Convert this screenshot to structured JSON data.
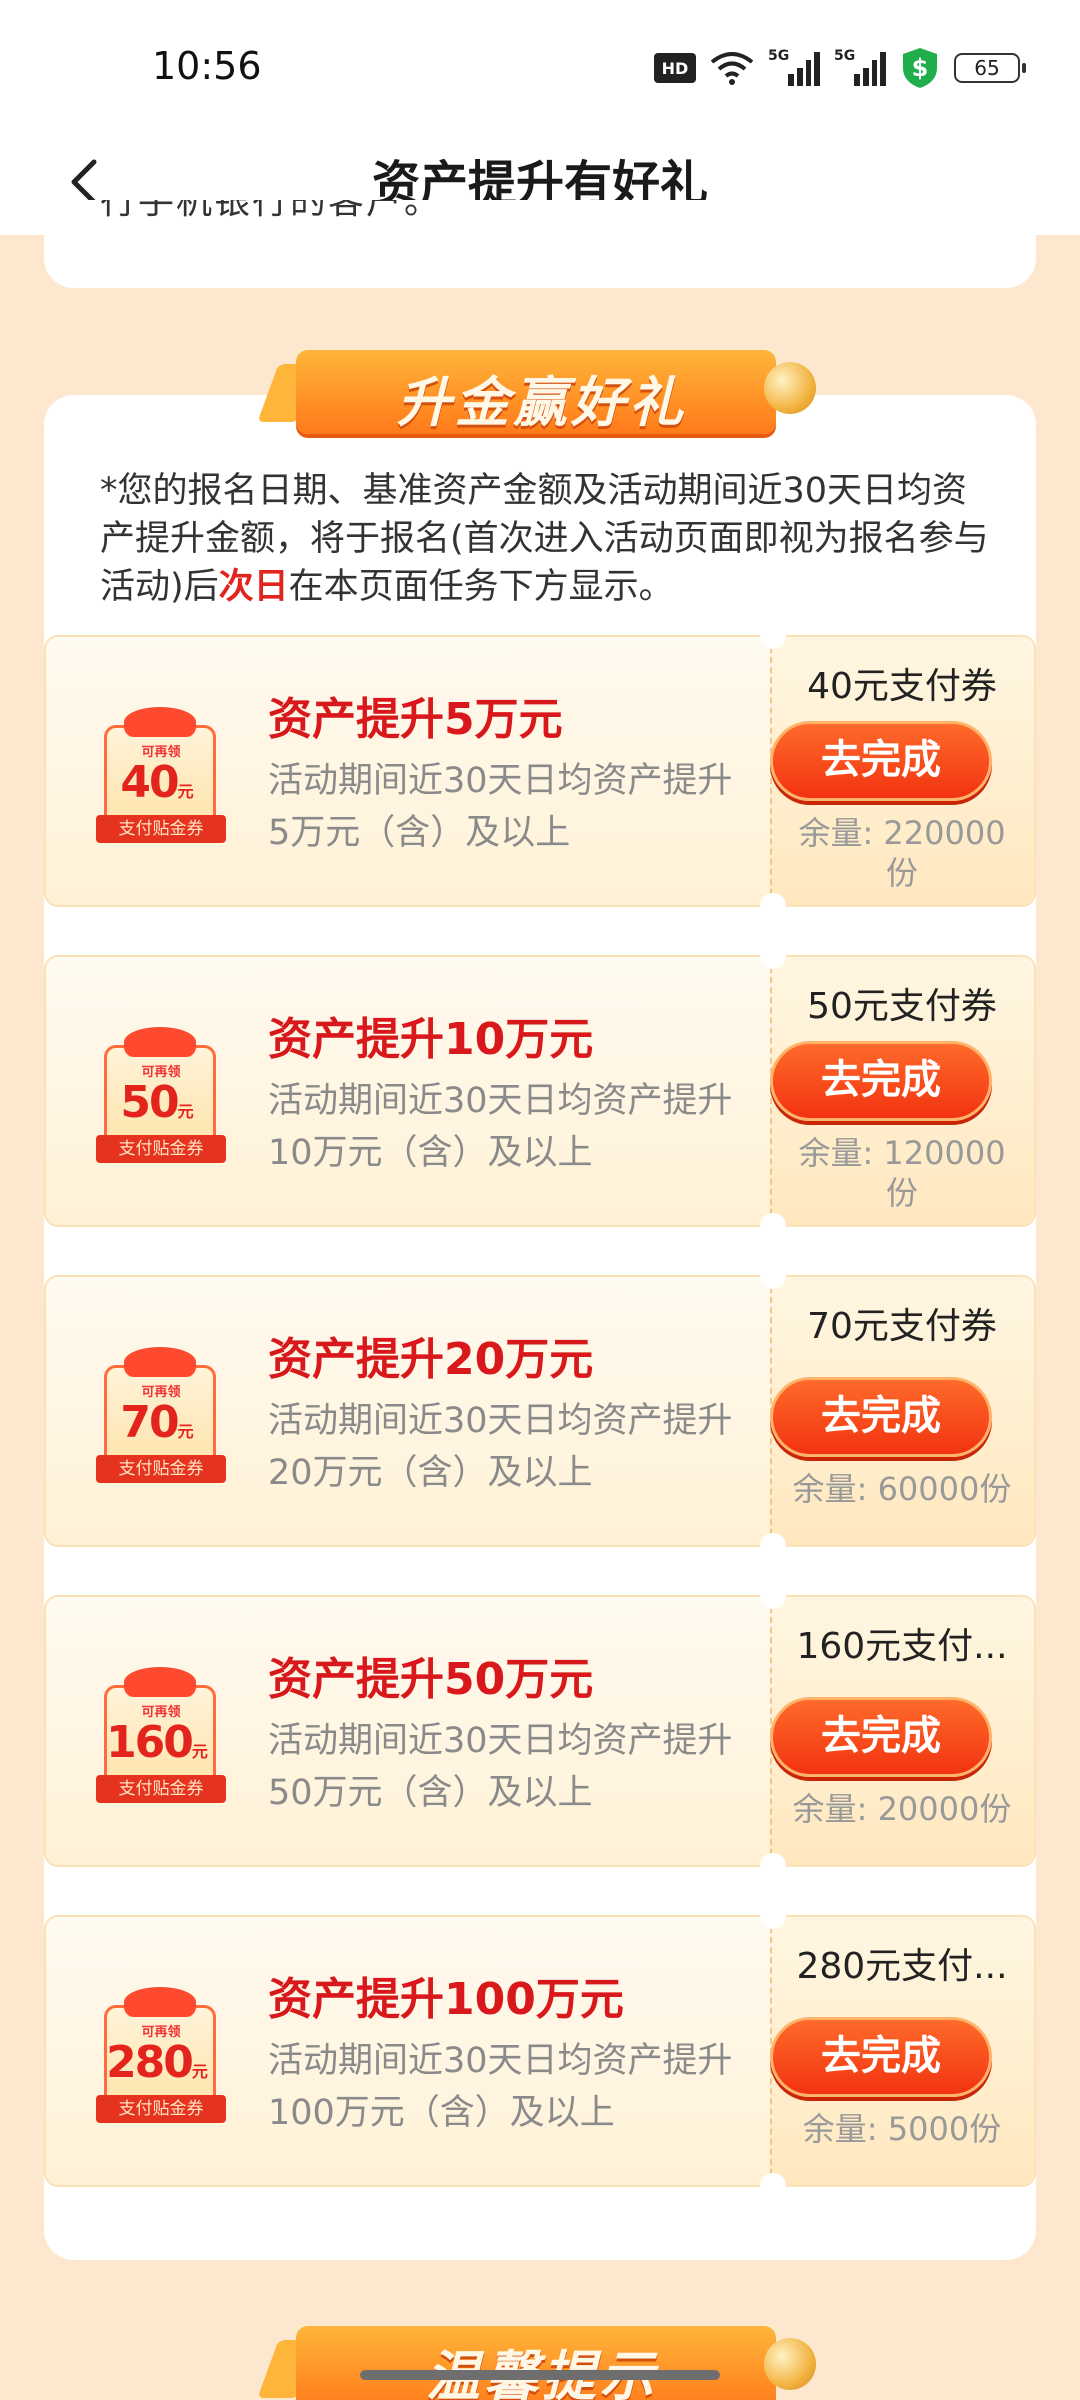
{
  "status_bar": {
    "time": "10:56",
    "hd_label": "HD",
    "sim1_label": "5G",
    "sim2_label": "5G",
    "battery": "65"
  },
  "header": {
    "title": "资产提升有好礼"
  },
  "top_card": {
    "truncated_text": "行手机银行的客户。"
  },
  "section_banner": {
    "title": "升金赢好礼"
  },
  "notice": {
    "part1": "*您的报名日期、基准资产金额及活动期间近30天日均资产提升金额，将于报名(首次进入活动页面即视为报名参与活动)后",
    "highlight": "次日",
    "part2": "在本页面任务下方显示。"
  },
  "tasks": [
    {
      "coupon_small": "可再领",
      "coupon_amount": "40",
      "coupon_unit": "元",
      "coupon_ribbon": "支付贴金券",
      "title": "资产提升5万元",
      "desc": "活动期间近30天日均资产提升5万元（含）及以上",
      "reward": "40元支付券",
      "button": "去完成",
      "remaining": "余量: 220000份"
    },
    {
      "coupon_small": "可再领",
      "coupon_amount": "50",
      "coupon_unit": "元",
      "coupon_ribbon": "支付贴金券",
      "title": "资产提升10万元",
      "desc": "活动期间近30天日均资产提升10万元（含）及以上",
      "reward": "50元支付券",
      "button": "去完成",
      "remaining": "余量: 120000份"
    },
    {
      "coupon_small": "可再领",
      "coupon_amount": "70",
      "coupon_unit": "元",
      "coupon_ribbon": "支付贴金券",
      "title": "资产提升20万元",
      "desc": "活动期间近30天日均资产提升20万元（含）及以上",
      "reward": "70元支付券",
      "button": "去完成",
      "remaining": "余量: 60000份"
    },
    {
      "coupon_small": "可再领",
      "coupon_amount": "160",
      "coupon_unit": "元",
      "coupon_ribbon": "支付贴金券",
      "title": "资产提升50万元",
      "desc": "活动期间近30天日均资产提升50万元（含）及以上",
      "reward": "160元支付...",
      "button": "去完成",
      "remaining": "余量: 20000份"
    },
    {
      "coupon_small": "可再领",
      "coupon_amount": "280",
      "coupon_unit": "元",
      "coupon_ribbon": "支付贴金券",
      "title": "资产提升100万元",
      "desc": "活动期间近30天日均资产提升100万元（含）及以上",
      "reward": "280元支付...",
      "button": "去完成",
      "remaining": "余量: 5000份"
    }
  ],
  "bottom_banner": {
    "title": "温馨提示"
  },
  "colors": {
    "page_bg": "#fde8cf",
    "accent_red": "#d9181b",
    "button_orange": "#f23311",
    "banner_orange": "#ff7a1a"
  }
}
